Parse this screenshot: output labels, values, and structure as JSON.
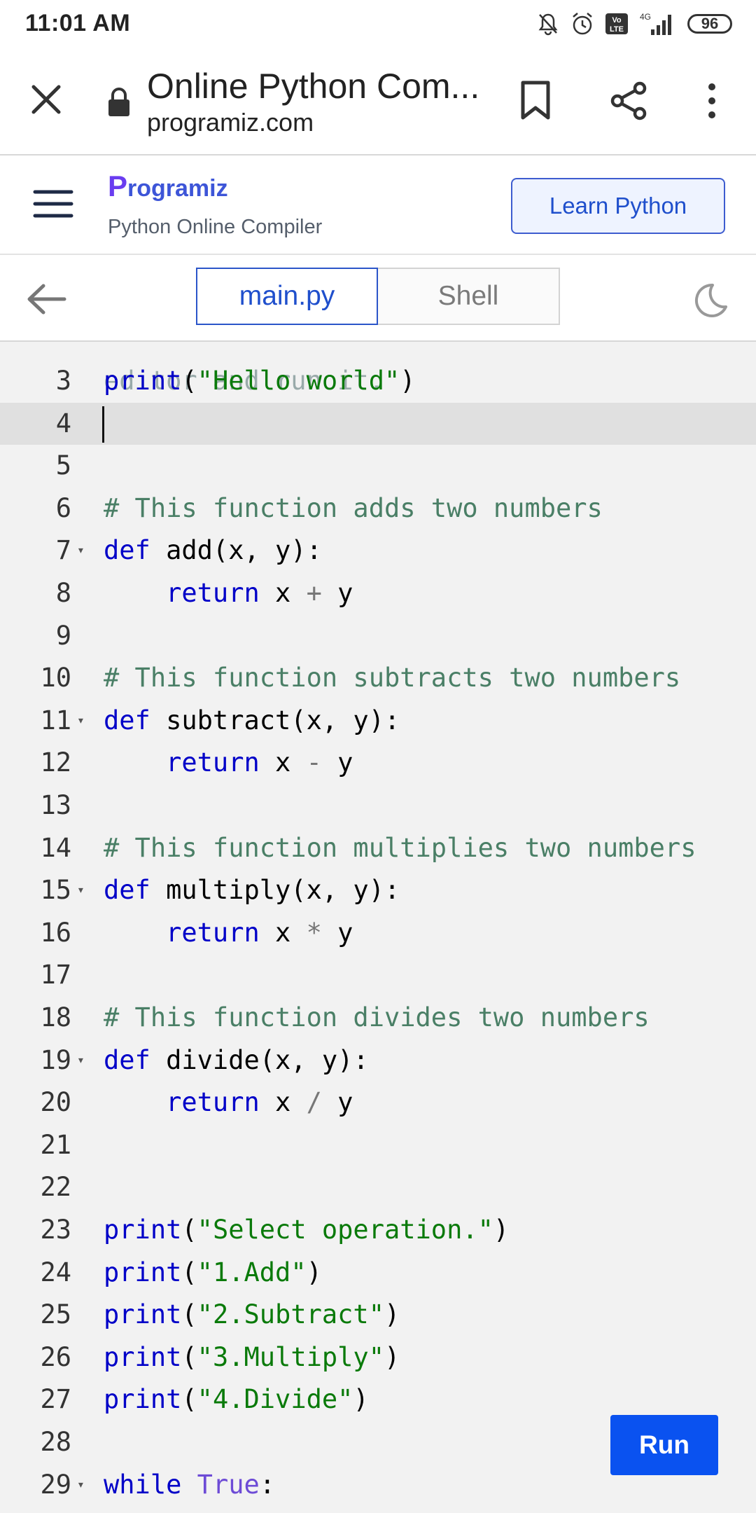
{
  "status_bar": {
    "time": "11:01 AM",
    "network": "4G",
    "volte": "Vo LTE",
    "battery": "96"
  },
  "browser": {
    "title": "Online Python Com...",
    "url": "programiz.com"
  },
  "site_header": {
    "logo_text": "rogramiz",
    "logo_initial": "P",
    "subtitle": "Python Online Compiler",
    "learn_button": "Learn Python"
  },
  "tabs": {
    "main": "main.py",
    "shell": "Shell"
  },
  "editor": {
    "partial_top": "editor and run it.",
    "lines": [
      {
        "n": "3",
        "tokens": [
          {
            "t": "print",
            "c": "kw"
          },
          {
            "t": "(",
            "c": ""
          },
          {
            "t": "\"Hello world\"",
            "c": "str"
          },
          {
            "t": ")",
            "c": ""
          }
        ]
      },
      {
        "n": "4",
        "tokens": [],
        "active": true
      },
      {
        "n": "5",
        "tokens": []
      },
      {
        "n": "6",
        "tokens": [
          {
            "t": "# This function adds two numbers",
            "c": "cmt"
          }
        ]
      },
      {
        "n": "7",
        "fold": true,
        "tokens": [
          {
            "t": "def",
            "c": "kw"
          },
          {
            "t": " add(x, y):",
            "c": ""
          }
        ]
      },
      {
        "n": "8",
        "tokens": [
          {
            "t": "    ",
            "c": ""
          },
          {
            "t": "return",
            "c": "kw"
          },
          {
            "t": " x ",
            "c": ""
          },
          {
            "t": "+",
            "c": "op"
          },
          {
            "t": " y",
            "c": ""
          }
        ]
      },
      {
        "n": "9",
        "tokens": []
      },
      {
        "n": "10",
        "tokens": [
          {
            "t": "# This function subtracts two numbers",
            "c": "cmt"
          }
        ]
      },
      {
        "n": "11",
        "fold": true,
        "tokens": [
          {
            "t": "def",
            "c": "kw"
          },
          {
            "t": " subtract(x, y):",
            "c": ""
          }
        ]
      },
      {
        "n": "12",
        "tokens": [
          {
            "t": "    ",
            "c": ""
          },
          {
            "t": "return",
            "c": "kw"
          },
          {
            "t": " x ",
            "c": ""
          },
          {
            "t": "-",
            "c": "op"
          },
          {
            "t": " y",
            "c": ""
          }
        ]
      },
      {
        "n": "13",
        "tokens": []
      },
      {
        "n": "14",
        "tokens": [
          {
            "t": "# This function multiplies two numbers",
            "c": "cmt"
          }
        ]
      },
      {
        "n": "15",
        "fold": true,
        "tokens": [
          {
            "t": "def",
            "c": "kw"
          },
          {
            "t": " multiply(x, y):",
            "c": ""
          }
        ]
      },
      {
        "n": "16",
        "tokens": [
          {
            "t": "    ",
            "c": ""
          },
          {
            "t": "return",
            "c": "kw"
          },
          {
            "t": " x ",
            "c": ""
          },
          {
            "t": "*",
            "c": "op"
          },
          {
            "t": " y",
            "c": ""
          }
        ]
      },
      {
        "n": "17",
        "tokens": []
      },
      {
        "n": "18",
        "tokens": [
          {
            "t": "# This function divides two numbers",
            "c": "cmt"
          }
        ]
      },
      {
        "n": "19",
        "fold": true,
        "tokens": [
          {
            "t": "def",
            "c": "kw"
          },
          {
            "t": " divide(x, y):",
            "c": ""
          }
        ]
      },
      {
        "n": "20",
        "tokens": [
          {
            "t": "    ",
            "c": ""
          },
          {
            "t": "return",
            "c": "kw"
          },
          {
            "t": " x ",
            "c": ""
          },
          {
            "t": "/",
            "c": "op"
          },
          {
            "t": " y",
            "c": ""
          }
        ]
      },
      {
        "n": "21",
        "tokens": []
      },
      {
        "n": "22",
        "tokens": []
      },
      {
        "n": "23",
        "tokens": [
          {
            "t": "print",
            "c": "kw"
          },
          {
            "t": "(",
            "c": ""
          },
          {
            "t": "\"Select operation.\"",
            "c": "str"
          },
          {
            "t": ")",
            "c": ""
          }
        ]
      },
      {
        "n": "24",
        "tokens": [
          {
            "t": "print",
            "c": "kw"
          },
          {
            "t": "(",
            "c": ""
          },
          {
            "t": "\"1.Add\"",
            "c": "str"
          },
          {
            "t": ")",
            "c": ""
          }
        ]
      },
      {
        "n": "25",
        "tokens": [
          {
            "t": "print",
            "c": "kw"
          },
          {
            "t": "(",
            "c": ""
          },
          {
            "t": "\"2.Subtract\"",
            "c": "str"
          },
          {
            "t": ")",
            "c": ""
          }
        ]
      },
      {
        "n": "26",
        "tokens": [
          {
            "t": "print",
            "c": "kw"
          },
          {
            "t": "(",
            "c": ""
          },
          {
            "t": "\"3.Multiply\"",
            "c": "str"
          },
          {
            "t": ")",
            "c": ""
          }
        ]
      },
      {
        "n": "27",
        "tokens": [
          {
            "t": "print",
            "c": "kw"
          },
          {
            "t": "(",
            "c": ""
          },
          {
            "t": "\"4.Divide\"",
            "c": "str"
          },
          {
            "t": ")",
            "c": ""
          }
        ]
      },
      {
        "n": "28",
        "tokens": []
      },
      {
        "n": "29",
        "fold": true,
        "tokens": [
          {
            "t": "while",
            "c": "kw"
          },
          {
            "t": " ",
            "c": ""
          },
          {
            "t": "True",
            "c": "builtin"
          },
          {
            "t": ":",
            "c": ""
          }
        ]
      }
    ]
  },
  "run_button": "Run",
  "colors": {
    "brand_blue": "#0a52f0",
    "keyword": "#0000c8",
    "string": "#0a7a0a",
    "comment": "#4a7f66"
  }
}
